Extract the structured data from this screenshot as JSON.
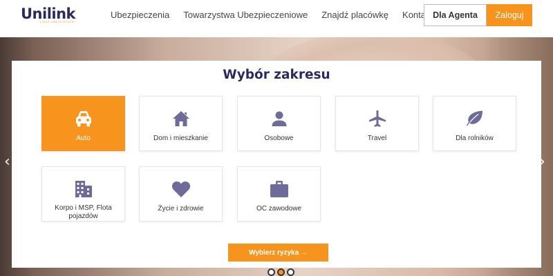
{
  "brand": {
    "name": "Unilink",
    "tagline": "LIDER UBEZPIECZEŃ"
  },
  "nav": [
    {
      "label": "Ubezpieczenia"
    },
    {
      "label": "Towarzystwa Ubezpieczeniowe"
    },
    {
      "label": "Znajdź placówkę"
    },
    {
      "label": "Kontakt"
    }
  ],
  "header_buttons": {
    "agent": "Dla Agenta",
    "login": "Zaloguj"
  },
  "section": {
    "title": "Wybór zakresu"
  },
  "tiles": [
    {
      "label": "Auto",
      "icon": "car-icon",
      "selected": true
    },
    {
      "label": "Dom i mieszkanie",
      "icon": "home-icon",
      "selected": false
    },
    {
      "label": "Osobowe",
      "icon": "person-icon",
      "selected": false
    },
    {
      "label": "Travel",
      "icon": "airplane-icon",
      "selected": false
    },
    {
      "label": "Dla rolników",
      "icon": "leaf-icon",
      "selected": false
    },
    {
      "label": "Korpo i MSP, Flota pojazdów",
      "icon": "building-icon",
      "selected": false
    },
    {
      "label": "Życie i zdrowie",
      "icon": "heart-icon",
      "selected": false
    },
    {
      "label": "OC zawodowe",
      "icon": "briefcase-icon",
      "selected": false
    }
  ],
  "cta": {
    "label": "Wybierz ryzyka →"
  },
  "carousel": {
    "arrow_prev": "‹",
    "arrow_next": "›",
    "active_slide": 2,
    "slides": 3
  },
  "colors": {
    "brand_navy": "#2b2a5e",
    "accent_orange": "#f7941d",
    "icon_purple": "#6e6a9a"
  }
}
